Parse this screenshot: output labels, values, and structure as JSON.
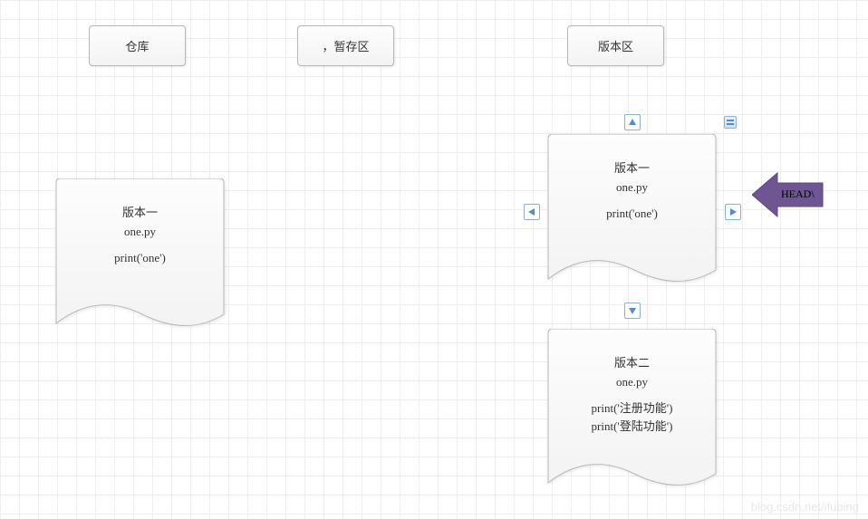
{
  "headers": {
    "repo": "仓库",
    "stage": "，暂存区",
    "version": "版本区"
  },
  "documents": {
    "repo_v1": {
      "title": "版本一",
      "file": "one.py",
      "code": [
        "print('one')"
      ]
    },
    "ver_v1": {
      "title": "版本一",
      "file": "one.py",
      "code": [
        "print('one')"
      ]
    },
    "ver_v2": {
      "title": "版本二",
      "file": "one.py",
      "code": [
        "print('注册功能')",
        "print('登陆功能')"
      ]
    }
  },
  "head_arrow": {
    "label": "HEAD\\",
    "fill": "#6d5691",
    "stroke": "#5c4880"
  },
  "watermark": "blog.csdn.net/ifubing"
}
